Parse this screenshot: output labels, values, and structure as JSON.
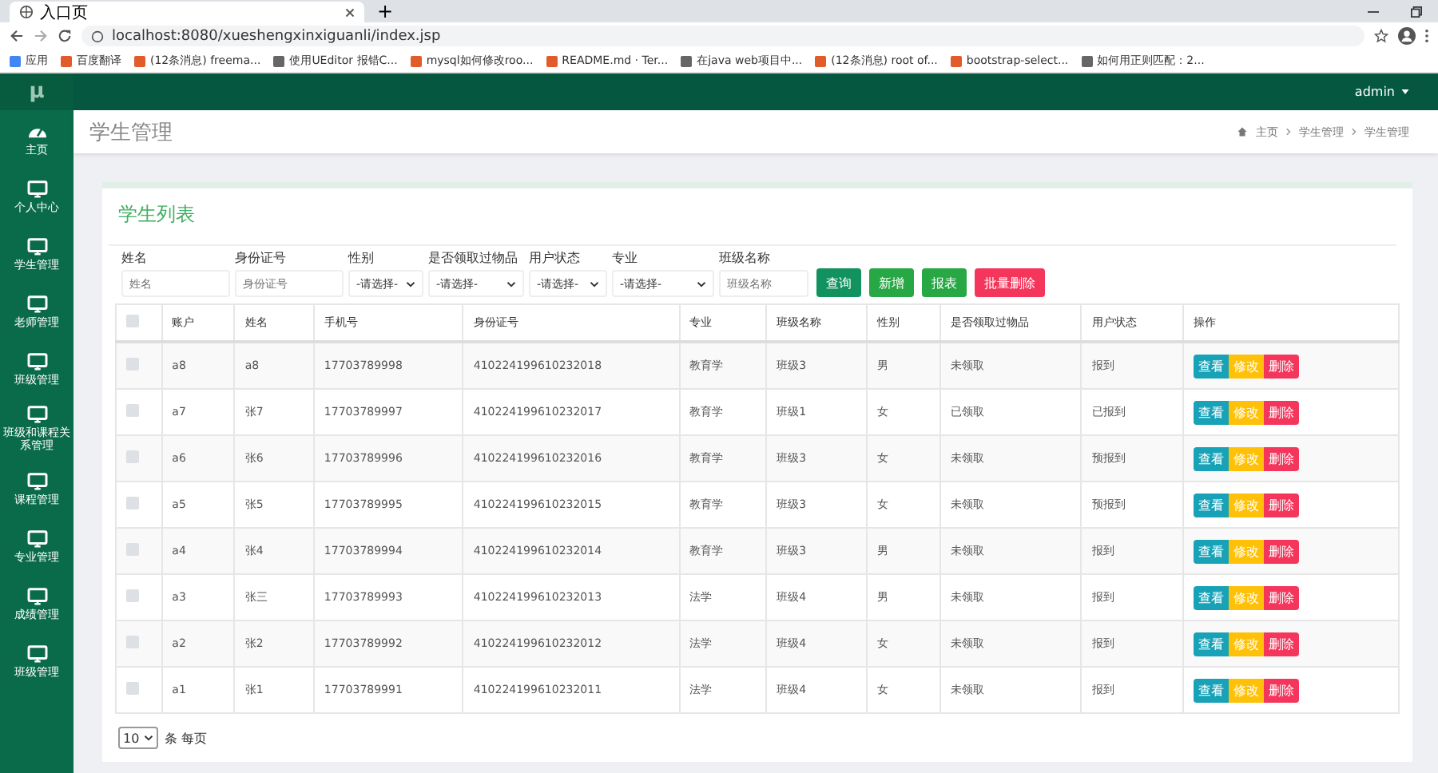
{
  "browser": {
    "tab_title": "入口页",
    "new_tab": "+",
    "url": "localhost:8080/xueshengxinxiguanli/index.jsp",
    "bookmarks": [
      "应用",
      "百度翻译",
      "(12条消息) freema...",
      "使用UEditor 报错C...",
      "mysql如何修改roo...",
      "README.md · Ter...",
      "在java web项目中...",
      "(12条消息) root of...",
      "bootstrap-select...",
      "如何用正则匹配：2..."
    ]
  },
  "app": {
    "logo": "μ",
    "user": "admin"
  },
  "sidebar": {
    "items": [
      {
        "label": "主页",
        "kind": "dashboard"
      },
      {
        "label": "个人中心",
        "kind": "monitor"
      },
      {
        "label": "学生管理",
        "kind": "monitor"
      },
      {
        "label": "老师管理",
        "kind": "monitor"
      },
      {
        "label": "班级管理",
        "kind": "monitor"
      },
      {
        "label": "班级和课程关系管理",
        "kind": "monitor"
      },
      {
        "label": "课程管理",
        "kind": "monitor"
      },
      {
        "label": "专业管理",
        "kind": "monitor"
      },
      {
        "label": "成绩管理",
        "kind": "monitor"
      },
      {
        "label": "班级管理",
        "kind": "monitor"
      }
    ]
  },
  "page_header": {
    "title": "学生管理",
    "breadcrumb": [
      "主页",
      "学生管理",
      "学生管理"
    ]
  },
  "panel": {
    "title": "学生列表",
    "filters": [
      {
        "label": "姓名",
        "kind": "input",
        "placeholder": "姓名"
      },
      {
        "label": "身份证号",
        "kind": "input",
        "placeholder": "身份证号"
      },
      {
        "label": "性别",
        "kind": "select",
        "value": "-请选择-"
      },
      {
        "label": "是否领取过物品",
        "kind": "select",
        "value": "-请选择-"
      },
      {
        "label": "用户状态",
        "kind": "select",
        "value": "-请选择-"
      },
      {
        "label": "专业",
        "kind": "select",
        "value": "-请选择-"
      },
      {
        "label": "班级名称",
        "kind": "input",
        "placeholder": "班级名称"
      }
    ],
    "buttons": [
      {
        "label": "查询",
        "kind": "query"
      },
      {
        "label": "新增",
        "kind": "add"
      },
      {
        "label": "报表",
        "kind": "report"
      },
      {
        "label": "批量删除",
        "kind": "delete"
      }
    ],
    "table": {
      "select_all_checked": false,
      "columns": [
        "账户",
        "姓名",
        "手机号",
        "身份证号",
        "专业",
        "班级名称",
        "性别",
        "是否领取过物品",
        "用户状态",
        "操作"
      ],
      "rows": [
        {
          "checked": false,
          "cells": [
            "a8",
            "a8",
            "17703789998",
            "410224199610232018",
            "教育学",
            "班级3",
            "男",
            "未领取",
            "报到"
          ],
          "actions": [
            "查看",
            "修改",
            "删除"
          ]
        },
        {
          "checked": false,
          "cells": [
            "a7",
            "张7",
            "17703789997",
            "410224199610232017",
            "教育学",
            "班级1",
            "女",
            "已领取",
            "已报到"
          ],
          "actions": [
            "查看",
            "修改",
            "删除"
          ]
        },
        {
          "checked": false,
          "cells": [
            "a6",
            "张6",
            "17703789996",
            "410224199610232016",
            "教育学",
            "班级3",
            "女",
            "未领取",
            "预报到"
          ],
          "actions": [
            "查看",
            "修改",
            "删除"
          ]
        },
        {
          "checked": false,
          "cells": [
            "a5",
            "张5",
            "17703789995",
            "410224199610232015",
            "教育学",
            "班级3",
            "女",
            "未领取",
            "预报到"
          ],
          "actions": [
            "查看",
            "修改",
            "删除"
          ]
        },
        {
          "checked": false,
          "cells": [
            "a4",
            "张4",
            "17703789994",
            "410224199610232014",
            "教育学",
            "班级3",
            "男",
            "未领取",
            "报到"
          ],
          "actions": [
            "查看",
            "修改",
            "删除"
          ]
        },
        {
          "checked": false,
          "cells": [
            "a3",
            "张三",
            "17703789993",
            "410224199610232013",
            "法学",
            "班级4",
            "男",
            "未领取",
            "报到"
          ],
          "actions": [
            "查看",
            "修改",
            "删除"
          ]
        },
        {
          "checked": false,
          "cells": [
            "a2",
            "张2",
            "17703789992",
            "410224199610232012",
            "法学",
            "班级4",
            "女",
            "未领取",
            "报到"
          ],
          "actions": [
            "查看",
            "修改",
            "删除"
          ]
        },
        {
          "checked": false,
          "cells": [
            "a1",
            "张1",
            "17703789991",
            "410224199610232011",
            "法学",
            "班级4",
            "女",
            "未领取",
            "报到"
          ],
          "actions": [
            "查看",
            "修改",
            "删除"
          ]
        }
      ]
    },
    "pagination": {
      "page_size": "10",
      "label": "条 每页"
    }
  }
}
